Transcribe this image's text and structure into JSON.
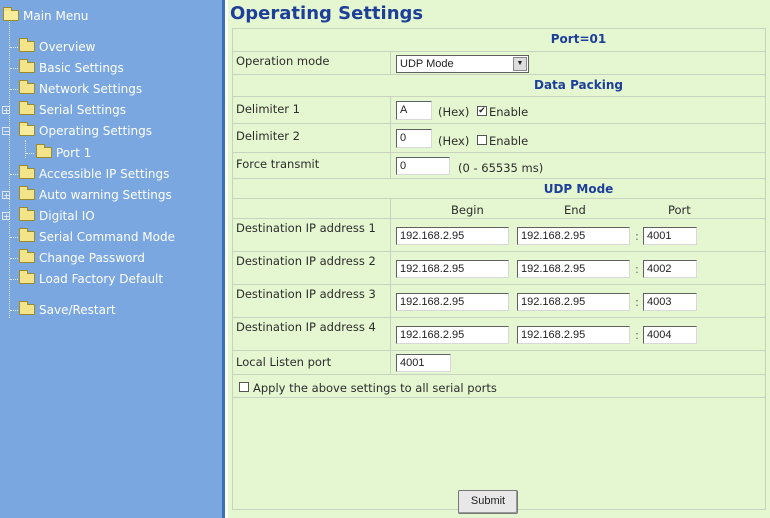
{
  "sidebar": {
    "root_label": "Main Menu",
    "items": [
      {
        "label": "Overview"
      },
      {
        "label": "Basic Settings"
      },
      {
        "label": "Network Settings"
      },
      {
        "label": "Serial Settings"
      },
      {
        "label": "Operating Settings"
      },
      {
        "label": "Port 1"
      },
      {
        "label": "Accessible IP Settings"
      },
      {
        "label": "Auto warning Settings"
      },
      {
        "label": "Digital IO"
      },
      {
        "label": "Serial Command Mode"
      },
      {
        "label": "Change Password"
      },
      {
        "label": "Load Factory Default"
      },
      {
        "label": "Save/Restart"
      }
    ]
  },
  "main": {
    "title": "Operating Settings",
    "port_header": "Port=01",
    "operation_mode": {
      "label": "Operation mode",
      "value": "UDP Mode"
    },
    "data_packing": {
      "header": "Data Packing",
      "delimiter1": {
        "label": "Delimiter 1",
        "value": "A",
        "hex": "(Hex)",
        "enable": "Enable",
        "checked": true
      },
      "delimiter2": {
        "label": "Delimiter 2",
        "value": "0",
        "hex": "(Hex)",
        "enable": "Enable",
        "checked": false
      },
      "force_transmit": {
        "label": "Force transmit",
        "value": "0",
        "range": "(0 - 65535 ms)"
      }
    },
    "udp_mode": {
      "header": "UDP Mode",
      "col_begin": "Begin",
      "col_end": "End",
      "col_port": "Port",
      "destinations": [
        {
          "label": "Destination IP address 1",
          "begin": "192.168.2.95",
          "end": "192.168.2.95",
          "port": "4001"
        },
        {
          "label": "Destination IP address 2",
          "begin": "192.168.2.95",
          "end": "192.168.2.95",
          "port": "4002"
        },
        {
          "label": "Destination IP address 3",
          "begin": "192.168.2.95",
          "end": "192.168.2.95",
          "port": "4003"
        },
        {
          "label": "Destination IP address 4",
          "begin": "192.168.2.95",
          "end": "192.168.2.95",
          "port": "4004"
        }
      ],
      "local_listen": {
        "label": "Local Listen port",
        "value": "4001"
      }
    },
    "apply_all": {
      "label": "Apply the above settings to all serial ports",
      "checked": false
    },
    "submit_label": "Submit",
    "separator": ":"
  }
}
